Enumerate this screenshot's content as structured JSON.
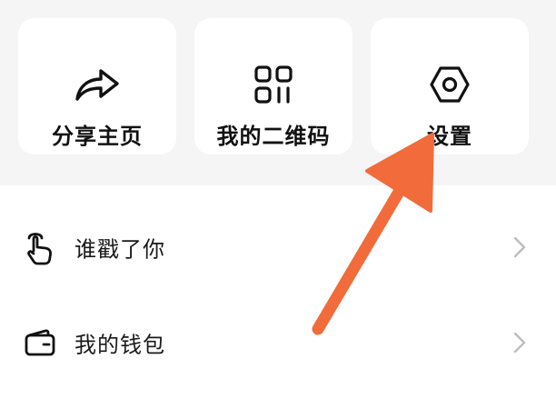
{
  "actions": {
    "share": {
      "label": "分享主页",
      "icon": "share-icon"
    },
    "qr": {
      "label": "我的二维码",
      "icon": "qr-code-icon"
    },
    "settings": {
      "label": "设置",
      "icon": "settings-hexagon-icon"
    }
  },
  "list": {
    "items": [
      {
        "label": "谁戳了你",
        "icon": "finger-tap-icon"
      },
      {
        "label": "我的钱包",
        "icon": "wallet-icon"
      }
    ]
  },
  "colors": {
    "band": "#f5f5f5",
    "card": "#ffffff",
    "text": "#111111",
    "chevron": "#bdbdbd",
    "arrow": "#f26b3a"
  }
}
